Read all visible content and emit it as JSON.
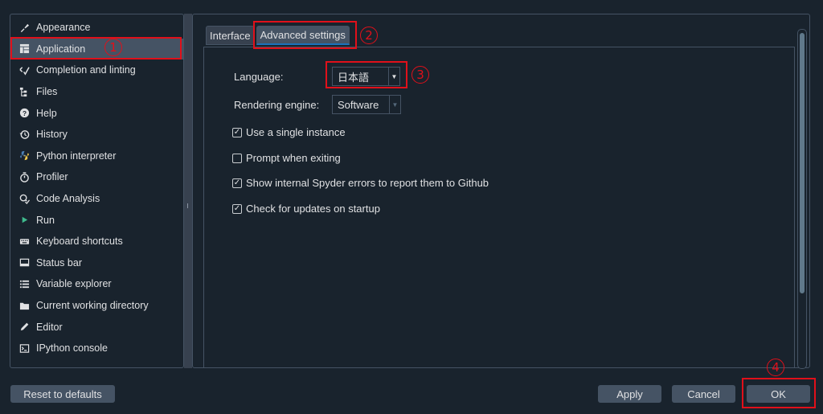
{
  "sidebar": {
    "items": [
      {
        "label": "Appearance",
        "icon": "brush-icon"
      },
      {
        "label": "Application",
        "icon": "layout-icon"
      },
      {
        "label": "Completion and linting",
        "icon": "completion-icon"
      },
      {
        "label": "Files",
        "icon": "files-icon"
      },
      {
        "label": "Help",
        "icon": "help-icon"
      },
      {
        "label": "History",
        "icon": "history-icon"
      },
      {
        "label": "Python interpreter",
        "icon": "python-icon"
      },
      {
        "label": "Profiler",
        "icon": "stopwatch-icon"
      },
      {
        "label": "Code Analysis",
        "icon": "code-analysis-icon"
      },
      {
        "label": "Run",
        "icon": "play-icon"
      },
      {
        "label": "Keyboard shortcuts",
        "icon": "keyboard-icon"
      },
      {
        "label": "Status bar",
        "icon": "status-bar-icon"
      },
      {
        "label": "Variable explorer",
        "icon": "list-icon"
      },
      {
        "label": "Current working directory",
        "icon": "folder-icon"
      },
      {
        "label": "Editor",
        "icon": "pencil-icon"
      },
      {
        "label": "IPython console",
        "icon": "console-icon"
      }
    ],
    "selected": "Application"
  },
  "tabs": [
    {
      "label": "Interface",
      "selected": false
    },
    {
      "label": "Advanced settings",
      "selected": true
    }
  ],
  "advanced": {
    "language_label": "Language:",
    "language_value": "日本語",
    "rendering_label": "Rendering engine:",
    "rendering_value": "Software",
    "options": [
      {
        "label": "Use a single instance",
        "checked": true
      },
      {
        "label": "Prompt when exiting",
        "checked": false
      },
      {
        "label": "Show internal Spyder errors to report them to Github",
        "checked": true
      },
      {
        "label": "Check for updates on startup",
        "checked": true
      }
    ]
  },
  "buttons": {
    "reset": "Reset to defaults",
    "apply": "Apply",
    "cancel": "Cancel",
    "ok": "OK"
  },
  "annotations": [
    "1",
    "2",
    "3",
    "4"
  ],
  "colors": {
    "background": "#19232d",
    "panel_border": "#455364",
    "selected_item": "#455364",
    "tab_accent": "#1a72bb",
    "annotation": "#e0101a"
  }
}
